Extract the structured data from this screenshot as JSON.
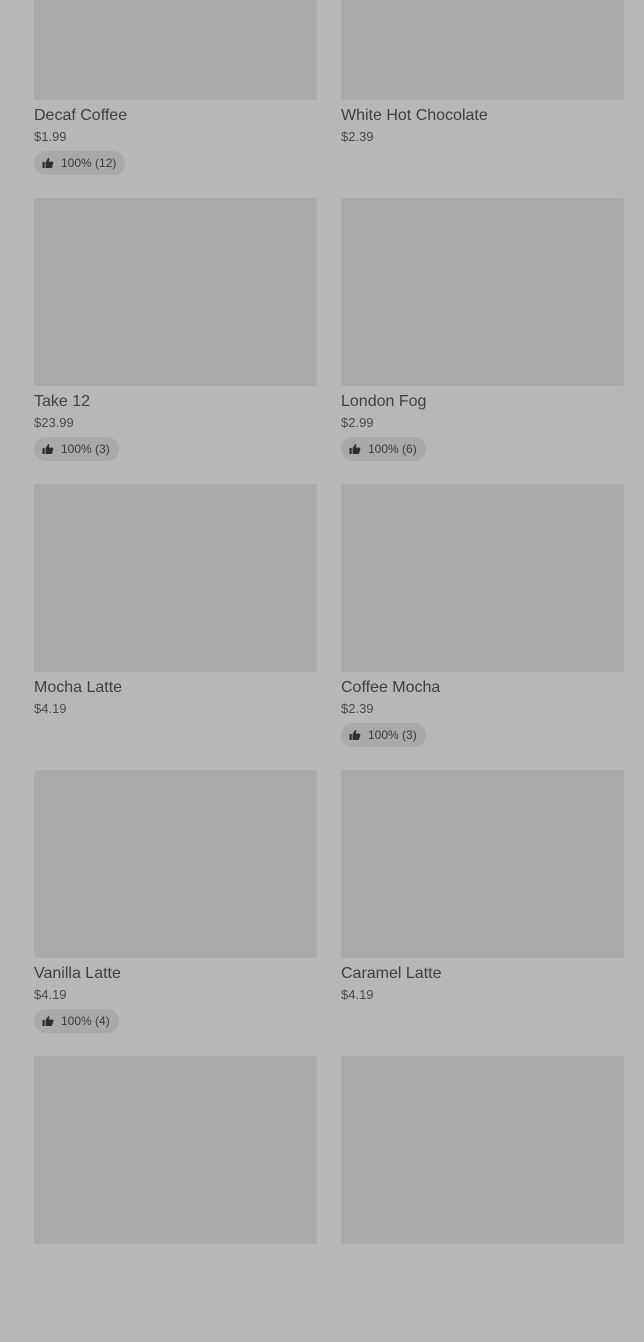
{
  "menu": {
    "items": [
      {
        "name": "Decaf Coffee",
        "price": "$1.99",
        "rating": "100% (12)"
      },
      {
        "name": "White Hot Chocolate",
        "price": "$2.39",
        "rating": ""
      },
      {
        "name": "Take 12",
        "price": "$23.99",
        "rating": "100% (3)"
      },
      {
        "name": "London Fog",
        "price": "$2.99",
        "rating": "100% (6)"
      },
      {
        "name": "Mocha Latte",
        "price": "$4.19",
        "rating": ""
      },
      {
        "name": "Coffee Mocha",
        "price": "$2.39",
        "rating": "100% (3)"
      },
      {
        "name": "Vanilla Latte",
        "price": "$4.19",
        "rating": "100% (4)"
      },
      {
        "name": "Caramel Latte",
        "price": "$4.19",
        "rating": ""
      },
      {
        "name": "",
        "price": "",
        "rating": ""
      },
      {
        "name": "",
        "price": "",
        "rating": ""
      }
    ]
  },
  "icons": {
    "rating_icon": "thumbs-up-icon"
  },
  "colors": {
    "background": "#b7b7b7",
    "image_placeholder": "#aaaaaa",
    "rating_pill": "#a9a9a9",
    "text": "#3f3f3f"
  }
}
